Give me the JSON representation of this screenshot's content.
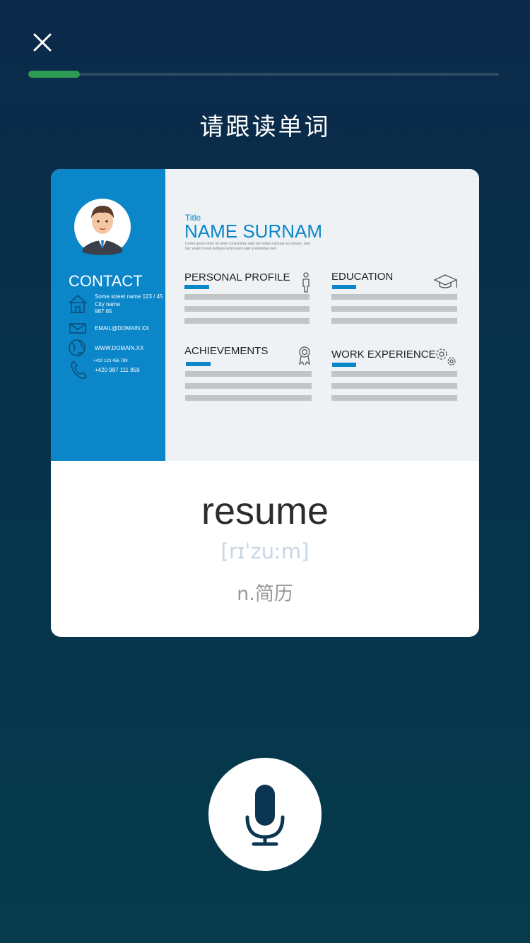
{
  "header": {
    "close_icon": "close-icon",
    "progress": 0.11
  },
  "prompt": {
    "title": "请跟读单词"
  },
  "card": {
    "illustration": {
      "contact_heading": "CONTACT",
      "address_line1": "Some street name 123 / 45",
      "address_line2": "City name",
      "address_line3": "987 65",
      "email": "EMAIL@DOMAIN.XX",
      "website": "WWW.DOMAIN.XX",
      "phone1": "+420 123 456 789",
      "phone2": "+420 987 111 859",
      "title_label": "Title",
      "name": "NAME SURNAM",
      "lorem1": "Lorem ipsum dolor sit amet consectetur odio non tellus natoque accumsan. Sed",
      "lorem2": "hac wsam Lorem tempus lactor justo eget scelerisque sed.",
      "section_profile": "PERSONAL PROFILE",
      "section_education": "EDUCATION",
      "section_achievements": "ACHIEVEMENTS",
      "section_work": "WORK EXPERIENCE"
    },
    "word": "resume",
    "phonetic": "[rɪˈzuːm]",
    "meaning": "n.简历"
  },
  "mic": {
    "icon": "microphone-icon"
  },
  "colors": {
    "accent_green": "#2e9b52",
    "resume_blue": "#0a86c9",
    "card_bg": "#ffffff"
  }
}
